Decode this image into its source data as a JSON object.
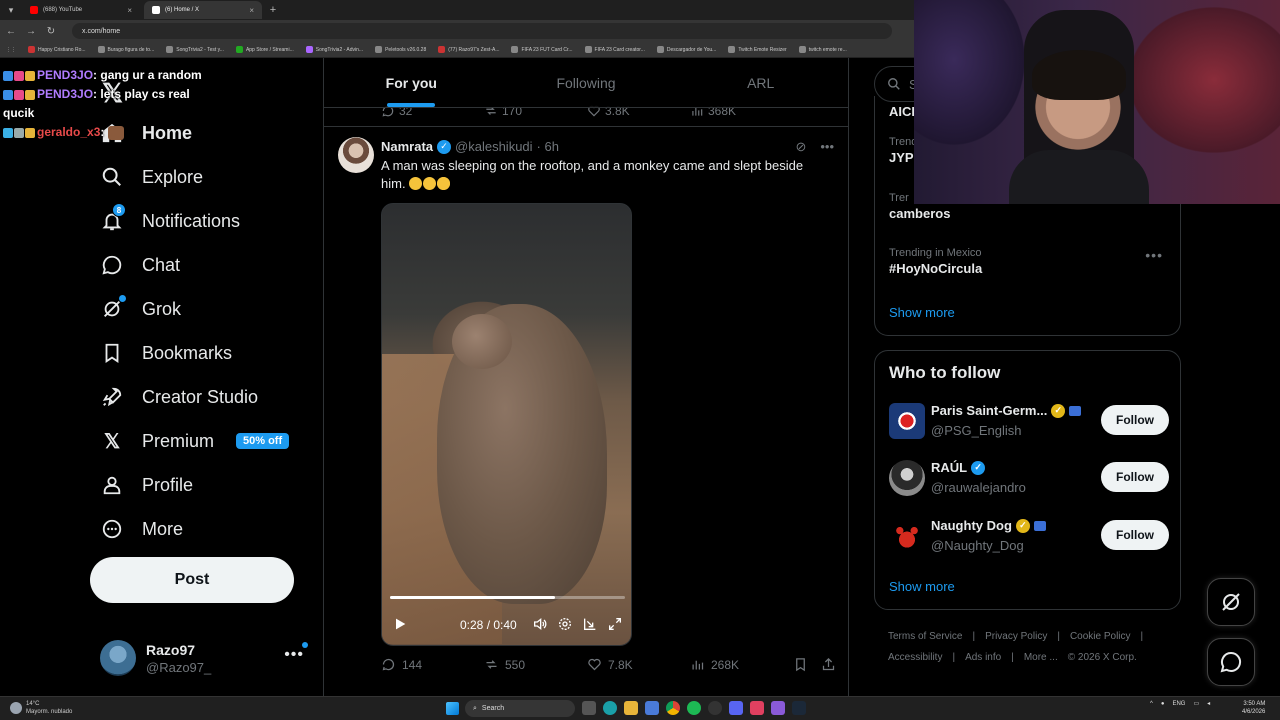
{
  "browser": {
    "tabs": [
      {
        "label": "(688) YouTube",
        "favicon_color": "#ff0000"
      },
      {
        "label": "(6) Home / X",
        "favicon_color": "#ffffff"
      }
    ],
    "url": "x.com/home",
    "bookmarks": [
      "Happy Cristiano Ro...",
      "Burago figura de to...",
      "SongTrivia2 - Test y...",
      "App Store / Streami...",
      "SongTrivia2 - Advin...",
      "Peletools v26.0.28",
      "(77) Razo97's Zest-A...",
      "FIFA 23 FUT Card Cr...",
      "FIFA 23 Card creator...",
      "Descargador de You...",
      "Twitch Emote Resizer",
      "twitch emote re..."
    ]
  },
  "chat": {
    "messages": [
      {
        "user": "PEND3JO",
        "text": ": gang ur a random",
        "user_color": "#b07cff"
      },
      {
        "user": "PEND3JO",
        "text": ": lets play cs real qucik",
        "user_color": "#b07cff"
      },
      {
        "user": "geraldo_x3",
        "text": ":",
        "user_color": "#e84a4a"
      }
    ]
  },
  "nav": {
    "items": [
      {
        "label": "Home",
        "icon": "home-icon"
      },
      {
        "label": "Explore",
        "icon": "search-icon"
      },
      {
        "label": "Notifications",
        "icon": "bell-icon",
        "badge": "8"
      },
      {
        "label": "Chat",
        "icon": "chat-icon"
      },
      {
        "label": "Grok",
        "icon": "grok-icon"
      },
      {
        "label": "Bookmarks",
        "icon": "bookmark-icon"
      },
      {
        "label": "Creator Studio",
        "icon": "rocket-icon"
      },
      {
        "label": "Premium",
        "icon": "x-premium-icon",
        "promo": "50% off"
      },
      {
        "label": "Profile",
        "icon": "person-icon"
      },
      {
        "label": "More",
        "icon": "more-circle-icon"
      }
    ],
    "post_label": "Post",
    "account": {
      "name": "Razo97",
      "handle": "@Razo97_"
    }
  },
  "feed": {
    "tabs": [
      "For you",
      "Following",
      "ARL"
    ],
    "active_tab": "For you",
    "previous_actions": {
      "replies": "32",
      "reposts": "170",
      "likes": "3.8K",
      "views": "368K"
    },
    "tweet": {
      "name": "Namrata",
      "handle": "@kaleshikudi",
      "time": "· 6h",
      "text_line1": "A man was sleeping on the rooftop, and a monkey came and slept beside",
      "text_line2": "him.",
      "video": {
        "time": "0:28 / 0:40",
        "progress": 0.7
      },
      "replies": "144",
      "reposts": "550",
      "likes": "7.8K",
      "views": "268K"
    }
  },
  "sidebar": {
    "search_placeholder": "Se",
    "trends": [
      {
        "meta": "",
        "title": "AICI"
      },
      {
        "meta": "Trend",
        "title": "JYPI"
      },
      {
        "meta": "Trer",
        "title": "camberos"
      },
      {
        "meta": "Trending in Mexico",
        "title": "#HoyNoCircula"
      }
    ],
    "trends_show_more": "Show more",
    "who_to_follow": {
      "title": "Who to follow",
      "accounts": [
        {
          "name": "Paris Saint-Germ...",
          "handle": "@PSG_English",
          "verified": "gold"
        },
        {
          "name": "RAÚL",
          "handle": "@rauwalejandro",
          "verified": "blue"
        },
        {
          "name": "Naughty Dog",
          "handle": "@Naughty_Dog",
          "verified": "gold"
        }
      ],
      "follow_label": "Follow",
      "show_more": "Show more"
    },
    "footer": [
      "Terms of Service",
      "|",
      "Privacy Policy",
      "|",
      "Cookie Policy",
      "|",
      "Accessibility",
      "|",
      "Ads info",
      "|",
      "More ...",
      "© 2026 X Corp."
    ]
  },
  "taskbar": {
    "weather_temp": "14°C",
    "weather_desc": "Mayorm. nublado",
    "search_label": "Search",
    "lang": "ENG",
    "time": "3:50 AM",
    "date": "4/6/2026"
  },
  "colors": {
    "accent": "#1d9bf0",
    "background": "#000000",
    "text": "#e7e9ea",
    "muted": "#71767b",
    "gold_check": "#e2b719"
  }
}
